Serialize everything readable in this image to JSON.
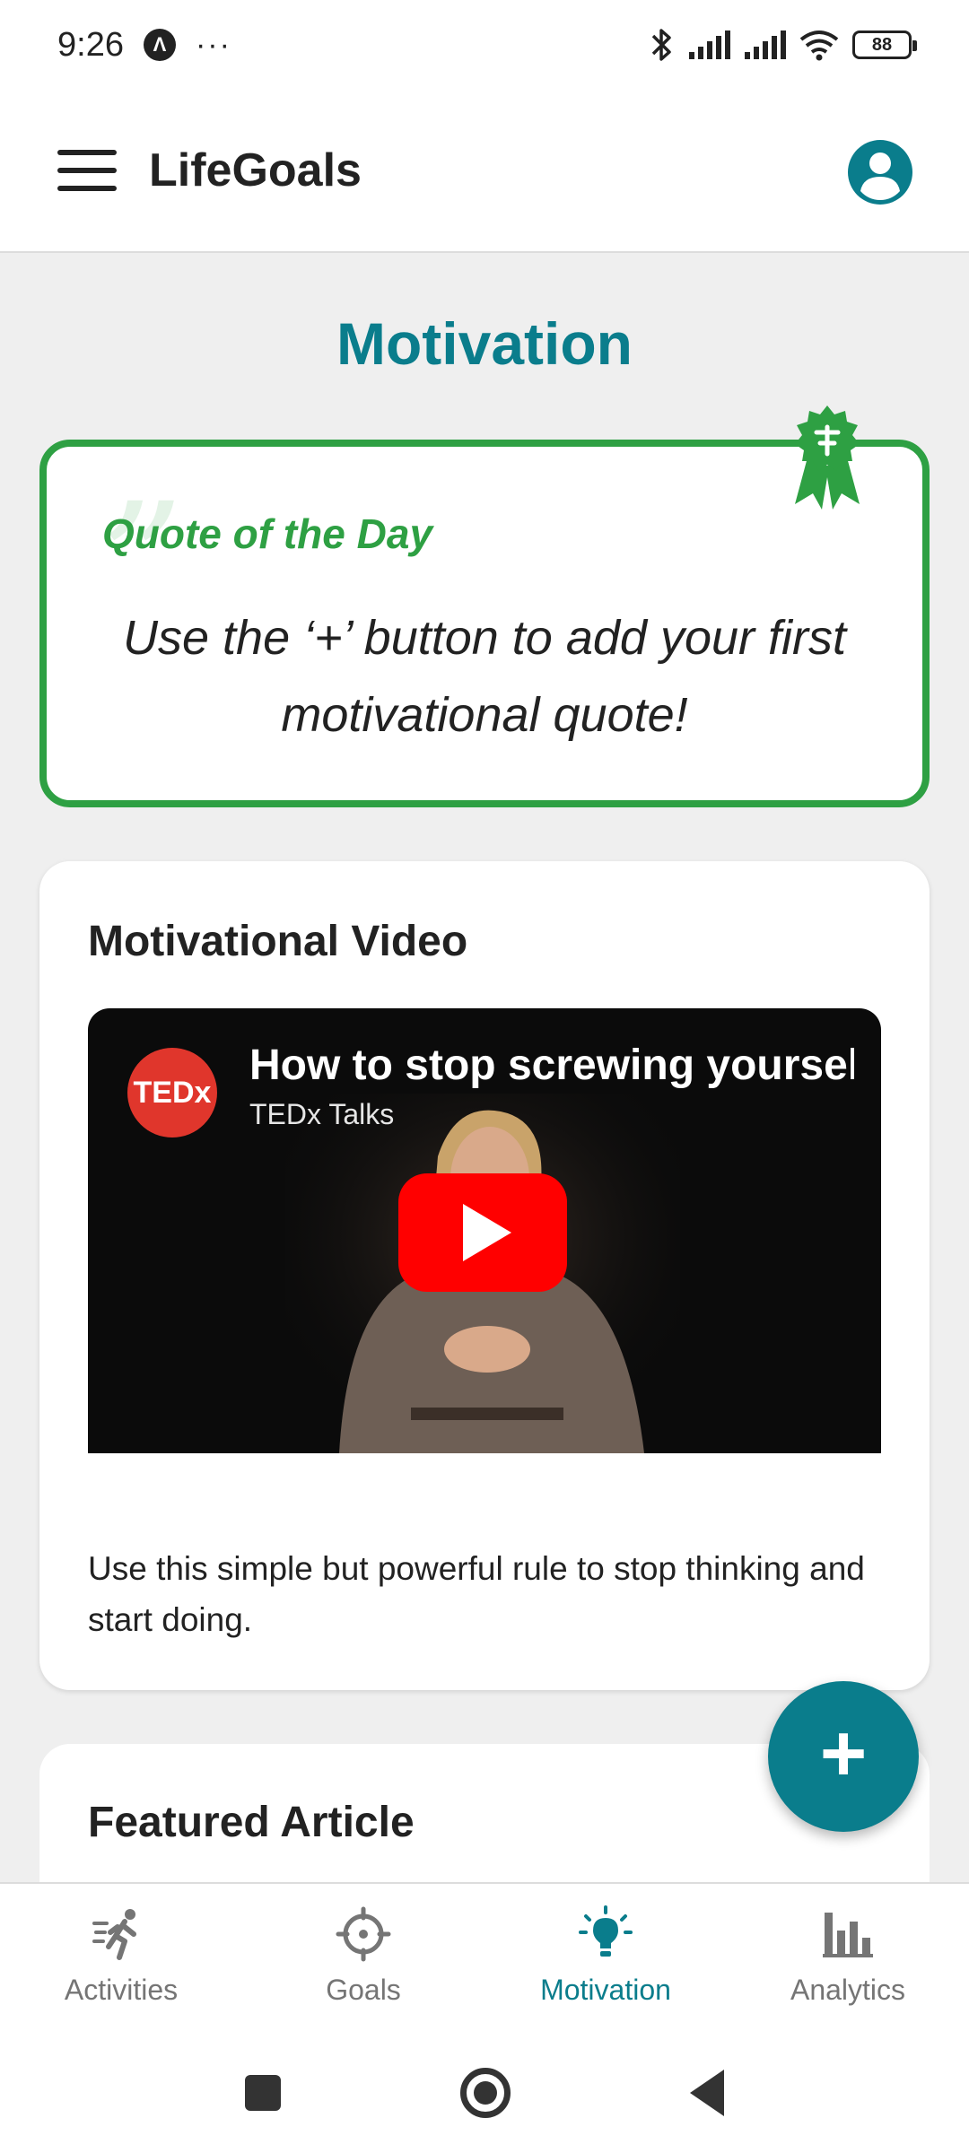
{
  "status_bar": {
    "time": "9:26",
    "app_icon_glyph": "Λ",
    "overflow": "···",
    "battery": "88",
    "icons": [
      "bluetooth-icon",
      "signal-icon",
      "signal-icon",
      "wifi-icon",
      "battery-icon"
    ]
  },
  "app_bar": {
    "title": "LifeGoals",
    "menu_icon": "menu-icon",
    "profile_icon": "account-circle-icon"
  },
  "page": {
    "title": "Motivation"
  },
  "quote_card": {
    "label": "Quote of the Day",
    "mark": "”",
    "text": "Use the ‘+’ button to add your first motivational quote!",
    "badge_icon": "award-badge-icon"
  },
  "video_card": {
    "heading": "Motivational Video",
    "video": {
      "title": "How to stop screwing yoursel",
      "channel": "TEDx Talks",
      "logo_text": "TEDx",
      "play_icon": "play-icon"
    },
    "description": "Use this simple but powerful rule to stop thinking and start doing."
  },
  "article_card": {
    "heading": "Featured Article"
  },
  "fab": {
    "label": "+"
  },
  "bottom_nav": {
    "items": [
      {
        "label": "Activities",
        "icon": "running-icon",
        "active": false
      },
      {
        "label": "Goals",
        "icon": "target-icon",
        "active": false
      },
      {
        "label": "Motivation",
        "icon": "lightbulb-icon",
        "active": true
      },
      {
        "label": "Analytics",
        "icon": "bar-chart-icon",
        "active": false
      }
    ]
  },
  "colors": {
    "primary": "#0a7d8c",
    "quote_green": "#2ea043",
    "background": "#efefef",
    "play_red": "#ff0000"
  }
}
